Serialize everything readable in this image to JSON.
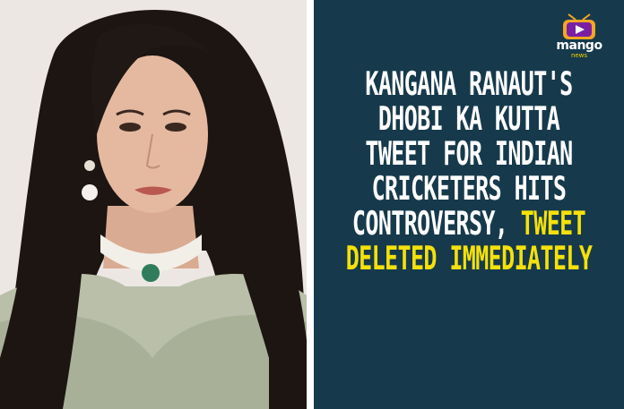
{
  "logo": {
    "icon": "tv-with-play-icon",
    "word": "mango",
    "sub": "news",
    "colors": {
      "screen": "#7b1fa2",
      "accent": "#f5a623",
      "text": "#ffffff"
    }
  },
  "headline": {
    "line1": "KANGANA RANAUT'S",
    "line2": "DHOBI KA KUTTA",
    "line3": "TWEET FOR INDIAN",
    "line4": "CRICKETERS HITS",
    "line5_white": "CONTROVERSY, ",
    "line5_yellow": "TWEET",
    "line6": "DELETED IMMEDIATELY"
  },
  "colors": {
    "panel_background": "#163a4c",
    "headline_white": "#ffffff",
    "headline_yellow": "#f5e10a"
  },
  "photo": {
    "subject": "portrait-photo",
    "background_color": "#ece6e2"
  }
}
